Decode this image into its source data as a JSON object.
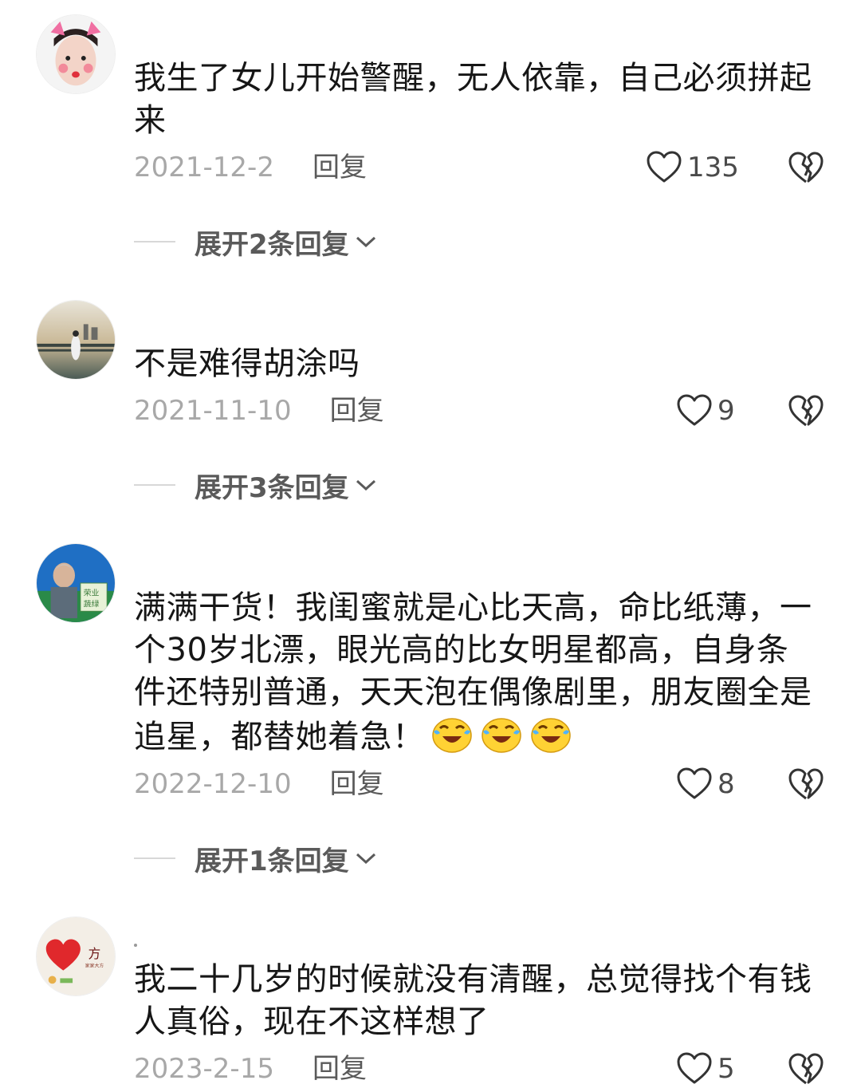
{
  "comments": [
    {
      "text": "我生了女儿开始警醒，无人依靠，自己必须拼起来",
      "date": "2021-12-2",
      "reply_label": "回复",
      "likes": "135",
      "expand_label": "展开2条回复"
    },
    {
      "text": "不是难得胡涂吗",
      "date": "2021-11-10",
      "reply_label": "回复",
      "likes": "9",
      "expand_label": "展开3条回复"
    },
    {
      "text": "满满干货！我闺蜜就是心比天高，命比纸薄，一个30岁北漂，眼光高的比女明星都高，自身条件还特别普通，天天泡在偶像剧里，朋友圈全是追星，都替她着急！",
      "date": "2022-12-10",
      "reply_label": "回复",
      "likes": "8",
      "expand_label": "展开1条回复"
    },
    {
      "text": "我二十几岁的时候就没有清醒，总觉得找个有钱人真俗，现在不这样想了",
      "date": "2023-2-15",
      "reply_label": "回复",
      "likes": "5"
    }
  ],
  "icons": {
    "like": "heart-outline-icon",
    "dislike": "broken-heart-icon",
    "expand": "chevron-down-icon",
    "emoji": "crying-laughing-emoji"
  },
  "colors": {
    "text": "#161616",
    "meta": "#a8a8a8",
    "action": "#5a5a5a"
  }
}
